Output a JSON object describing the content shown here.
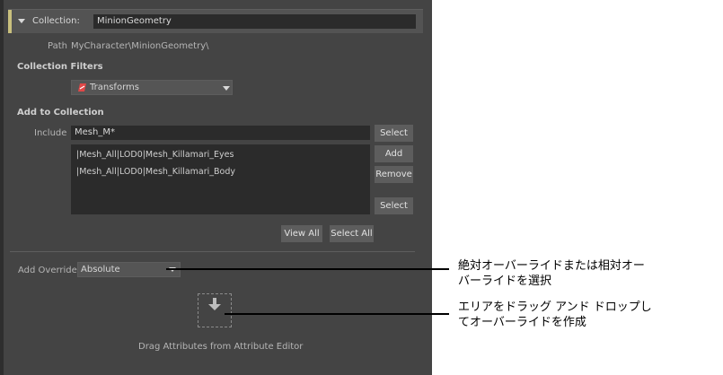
{
  "collection": {
    "label": "Collection:",
    "name": "MinionGeometry",
    "path_label": "Path",
    "path_value": "MyCharacter\\MinionGeometry\\"
  },
  "filters": {
    "heading": "Collection Filters",
    "selected": "Transforms"
  },
  "add_to_collection": {
    "heading": "Add to Collection",
    "include_label": "Include",
    "include_value": "Mesh_M*",
    "items": [
      "|Mesh_All|LOD0|Mesh_Killamari_Eyes",
      "|Mesh_All|LOD0|Mesh_Killamari_Body"
    ],
    "buttons": {
      "select_top": "Select",
      "add": "Add",
      "remove": "Remove",
      "select_bottom": "Select",
      "view_all": "View All",
      "select_all": "Select All"
    }
  },
  "override": {
    "label": "Add Override",
    "value": "Absolute"
  },
  "drop_zone": {
    "caption": "Drag Attributes from Attribute Editor"
  },
  "callouts": {
    "override_line1": "絶対オーバーライドまたは相対オー",
    "override_line2": "バーライドを選択",
    "drop_line1": "エリアをドラッグ アンド ドロップし",
    "drop_line2": "てオーバーライドを作成"
  },
  "colors": {
    "panel": "#444444",
    "accent": "#c9c07d",
    "field": "#2b2b2b",
    "button": "#5d5d5d"
  }
}
